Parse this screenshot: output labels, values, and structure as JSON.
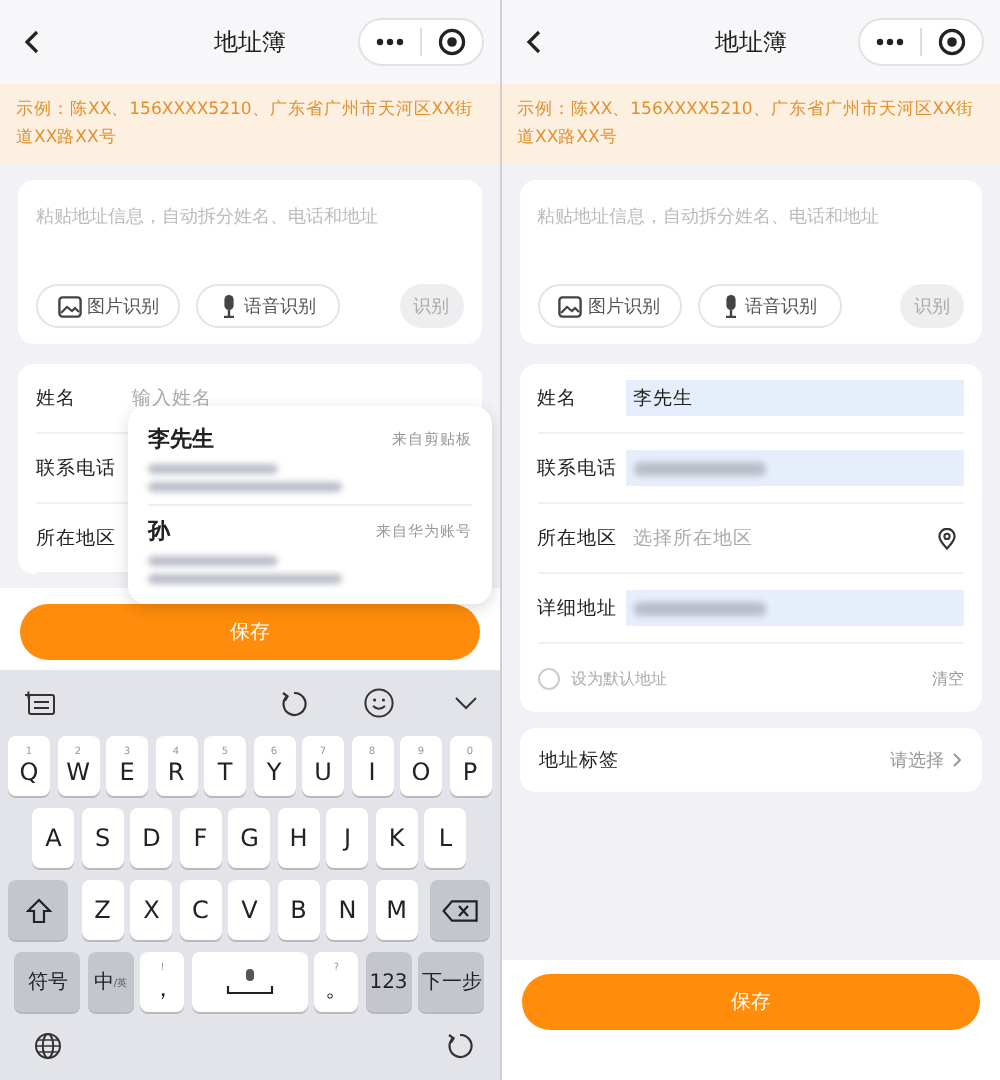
{
  "screens": [
    {
      "title": "地址簿",
      "notice": "示例：陈XX、156XXXX5210、广东省广州市天河区XX街道XX路XX号",
      "paste": {
        "placeholder": "粘贴地址信息，自动拆分姓名、电话和地址",
        "buttons": [
          {
            "label": "图片识别",
            "kind": "image",
            "disabled": false
          },
          {
            "label": "语音识别",
            "kind": "voice",
            "disabled": false
          },
          {
            "label": "识别",
            "kind": "plain",
            "disabled": true
          }
        ]
      },
      "fields": [
        {
          "label": "姓名",
          "kind": "input",
          "placeholder": "输入姓名"
        },
        {
          "label": "联系电话",
          "kind": "empty"
        },
        {
          "label": "所在地区",
          "kind": "empty"
        }
      ],
      "suggestions": [
        {
          "name": "李先生",
          "source": "来自剪贴板"
        },
        {
          "name": "孙",
          "source": "来自华为账号"
        }
      ],
      "save": "保存",
      "keyboard": {
        "rows": [
          {
            "keys": [
              {
                "kind": "letter",
                "label": "Q",
                "hint": "1"
              },
              {
                "kind": "letter",
                "label": "W",
                "hint": "2"
              },
              {
                "kind": "letter",
                "label": "E",
                "hint": "3"
              },
              {
                "kind": "letter",
                "label": "R",
                "hint": "4"
              },
              {
                "kind": "letter",
                "label": "T",
                "hint": "5"
              },
              {
                "kind": "letter",
                "label": "Y",
                "hint": "6"
              },
              {
                "kind": "letter",
                "label": "U",
                "hint": "7"
              },
              {
                "kind": "letter",
                "label": "I",
                "hint": "8"
              },
              {
                "kind": "letter",
                "label": "O",
                "hint": "9"
              },
              {
                "kind": "letter",
                "label": "P",
                "hint": "0"
              }
            ]
          },
          {
            "keys": [
              {
                "kind": "letter",
                "label": "A"
              },
              {
                "kind": "letter",
                "label": "S"
              },
              {
                "kind": "letter",
                "label": "D"
              },
              {
                "kind": "letter",
                "label": "F"
              },
              {
                "kind": "letter",
                "label": "G"
              },
              {
                "kind": "letter",
                "label": "H"
              },
              {
                "kind": "letter",
                "label": "J"
              },
              {
                "kind": "letter",
                "label": "K"
              },
              {
                "kind": "letter",
                "label": "L"
              }
            ]
          },
          {
            "keys": [
              {
                "kind": "shift"
              },
              {
                "kind": "letter",
                "label": "Z"
              },
              {
                "kind": "letter",
                "label": "X"
              },
              {
                "kind": "letter",
                "label": "C"
              },
              {
                "kind": "letter",
                "label": "V"
              },
              {
                "kind": "letter",
                "label": "B"
              },
              {
                "kind": "letter",
                "label": "N"
              },
              {
                "kind": "letter",
                "label": "M"
              },
              {
                "kind": "backspace"
              }
            ]
          },
          {
            "keys": [
              {
                "kind": "func",
                "label": "符号"
              },
              {
                "kind": "func",
                "label": "中",
                "sub": "/英"
              },
              {
                "kind": "punct",
                "label": "，",
                "hint": "!"
              },
              {
                "kind": "space"
              },
              {
                "kind": "punct",
                "label": "。",
                "hint": "?"
              },
              {
                "kind": "func",
                "label": "123"
              },
              {
                "kind": "func",
                "label": "下一步"
              }
            ]
          }
        ]
      }
    },
    {
      "title": "地址簿",
      "notice": "示例：陈XX、156XXXX5210、广东省广州市天河区XX街道XX路XX号",
      "paste": {
        "placeholder": "粘贴地址信息，自动拆分姓名、电话和地址",
        "buttons": [
          {
            "label": "图片识别",
            "kind": "image",
            "disabled": false
          },
          {
            "label": "语音识别",
            "kind": "voice",
            "disabled": false
          },
          {
            "label": "识别",
            "kind": "plain",
            "disabled": true
          }
        ]
      },
      "fields": [
        {
          "label": "姓名",
          "kind": "input",
          "value": "李先生",
          "autofilled": true
        },
        {
          "label": "联系电话",
          "kind": "blurred",
          "autofilled": true
        },
        {
          "label": "所在地区",
          "kind": "location",
          "placeholder": "选择所在地区",
          "autofilled": false
        },
        {
          "label": "详细地址",
          "kind": "blurred",
          "autofilled": true
        }
      ],
      "default": {
        "label": "设为默认地址",
        "checked": false,
        "clear": "清空"
      },
      "tag": {
        "label": "地址标签",
        "value": "请选择"
      },
      "save": "保存"
    }
  ]
}
